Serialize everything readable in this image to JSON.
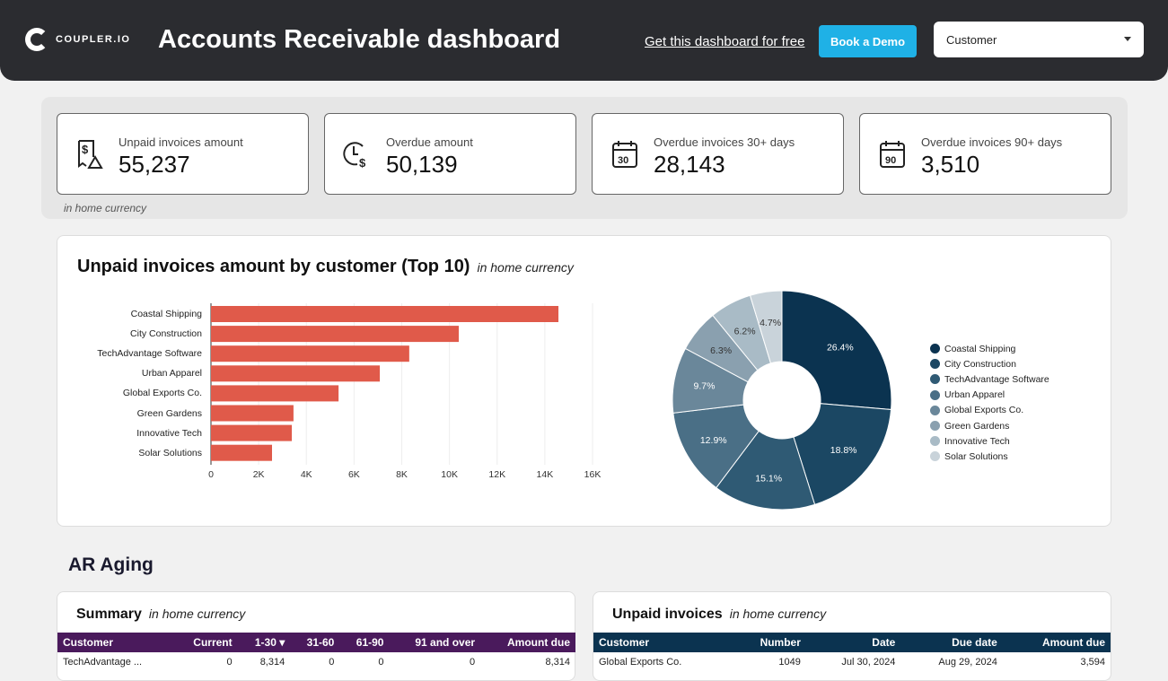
{
  "header": {
    "logo": "COUPLER.IO",
    "title": "Accounts Receivable dashboard",
    "link": "Get this dashboard for free",
    "demo": "Book a Demo",
    "filter": "Customer"
  },
  "kpis": [
    {
      "label": "Unpaid invoices amount",
      "value": "55,237",
      "icon": "receipt-warning-icon"
    },
    {
      "label": "Overdue amount",
      "value": "50,139",
      "icon": "clock-dollar-icon"
    },
    {
      "label": "Overdue invoices 30+ days",
      "value": "28,143",
      "icon": "calendar-30-icon"
    },
    {
      "label": "Overdue invoices 90+ days",
      "value": "3,510",
      "icon": "calendar-90-icon"
    }
  ],
  "kpi_note": "in home currency",
  "chart_card": {
    "title": "Unpaid invoices amount by customer (Top 10)",
    "subtitle": "in home currency"
  },
  "chart_data": [
    {
      "type": "bar",
      "orientation": "horizontal",
      "categories": [
        "Coastal Shipping",
        "City Construction",
        "TechAdvantage Software",
        "Urban Apparel",
        "Global Exports Co.",
        "Green Gardens",
        "Innovative Tech",
        "Solar Solutions"
      ],
      "values": [
        14570,
        10390,
        8314,
        7080,
        5350,
        3460,
        3390,
        2560
      ],
      "xlim": [
        0,
        16000
      ],
      "xticks": [
        "0",
        "2K",
        "4K",
        "6K",
        "8K",
        "10K",
        "12K",
        "14K",
        "16K"
      ],
      "color": "#e05a4a",
      "grid": true
    },
    {
      "type": "pie",
      "donut": true,
      "categories": [
        "Coastal Shipping",
        "City Construction",
        "TechAdvantage Software",
        "Urban Apparel",
        "Global Exports Co.",
        "Green Gardens",
        "Innovative Tech",
        "Solar Solutions"
      ],
      "values": [
        26.4,
        18.8,
        15.1,
        12.9,
        9.7,
        6.3,
        6.2,
        4.7
      ],
      "labels": [
        "26.4%",
        "18.8%",
        "15.1%",
        "12.9%",
        "9.7%",
        "6.3%",
        "6.2%",
        "4.7%"
      ],
      "colors": [
        "#0b3350",
        "#1b4763",
        "#2f5a74",
        "#4a6f86",
        "#6a879a",
        "#8aa0af",
        "#a9bbc6",
        "#c9d3da"
      ],
      "legend": "right"
    }
  ],
  "aging": {
    "title": "AR Aging",
    "summary": {
      "title": "Summary",
      "subtitle": "in home currency",
      "header_color": "#4a1a5c",
      "columns": [
        "Customer",
        "Current",
        "1-30 ▾",
        "31-60",
        "61-90",
        "91 and over",
        "Amount due"
      ],
      "rows": [
        [
          "TechAdvantage ...",
          "0",
          "8,314",
          "0",
          "0",
          "0",
          "8,314"
        ]
      ]
    },
    "unpaid": {
      "title": "Unpaid invoices",
      "subtitle": "in home currency",
      "header_color": "#0b3350",
      "columns": [
        "Customer",
        "Number",
        "Date",
        "Due date",
        "Amount due"
      ],
      "rows": [
        [
          "Global Exports Co.",
          "1049",
          "Jul 30, 2024",
          "Aug 29, 2024",
          "3,594"
        ]
      ]
    }
  }
}
